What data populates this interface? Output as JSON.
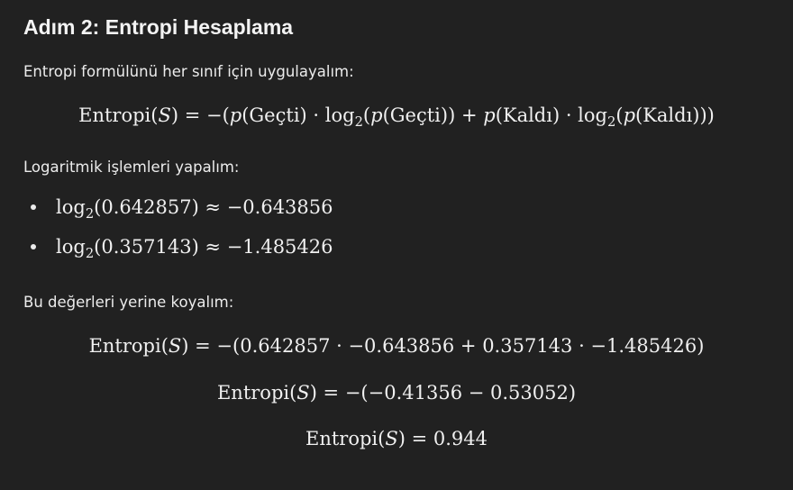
{
  "heading": "Adım 2: Entropi Hesaplama",
  "intro": "Entropi formülünü her sınıf için uygulayalım:",
  "formula": {
    "lhs": "Entropi(",
    "S": "S",
    "mid1": ") = −(",
    "p1": "p",
    "gecti1": "(Geçti) · log",
    "sub1": "2",
    "open1": "(",
    "p2": "p",
    "gecti2": "(Geçti)) + ",
    "p3": "p",
    "kaldi1": "(Kaldı) · log",
    "sub2": "2",
    "open2": "(",
    "p4": "p",
    "kaldi2": "(Kaldı)))"
  },
  "log_intro": "Logaritmik işlemleri yapalım:",
  "logs": [
    {
      "fn": "log",
      "sub": "2",
      "expr": "(0.642857) ≈ −0.643856"
    },
    {
      "fn": "log",
      "sub": "2",
      "expr": "(0.357143) ≈ −1.485426"
    }
  ],
  "substitute_intro": "Bu değerleri yerine koyalım:",
  "steps": [
    {
      "pre": "Entropi(",
      "S": "S",
      "post": ") = −(0.642857 · −0.643856 + 0.357143 · −1.485426)"
    },
    {
      "pre": "Entropi(",
      "S": "S",
      "post": ") = −(−0.41356 − 0.53052)"
    },
    {
      "pre": "Entropi(",
      "S": "S",
      "post": ") = 0.944"
    }
  ]
}
